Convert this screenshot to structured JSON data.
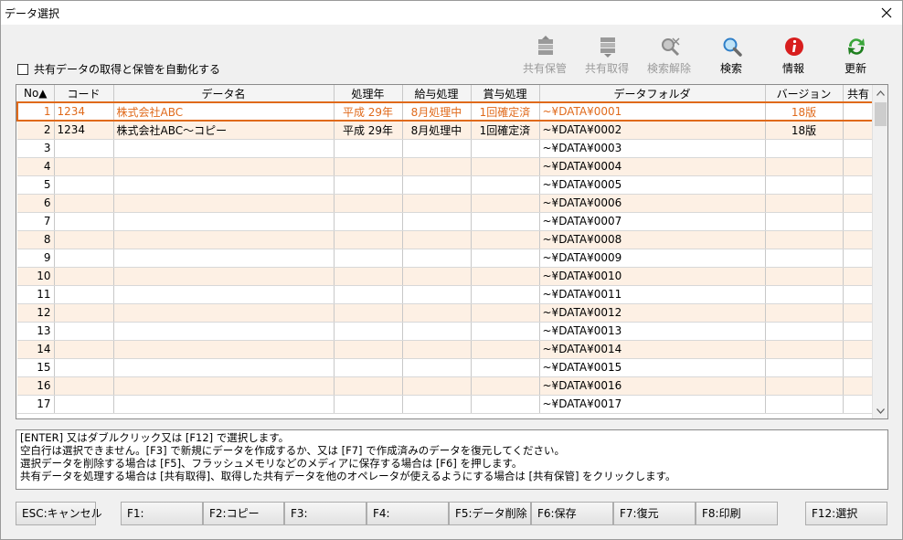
{
  "window": {
    "title": "データ選択"
  },
  "autosync": {
    "label": "共有データの取得と保管を自動化する",
    "checked": false
  },
  "toolbar": {
    "share_save": "共有保管",
    "share_get": "共有取得",
    "search_clear": "検索解除",
    "search": "検索",
    "info": "情報",
    "refresh": "更新"
  },
  "grid": {
    "columns": [
      "No▲",
      "コード",
      "データ名",
      "処理年",
      "給与処理",
      "賞与処理",
      "データフォルダ",
      "バージョン",
      "共有"
    ],
    "rows": [
      {
        "no": "1",
        "code": "1234",
        "name": "株式会社ABC",
        "year": "平成 29年",
        "salary": "8月処理中",
        "bonus": "1回確定済",
        "folder": "~¥DATA¥0001",
        "version": "18版",
        "shared": ""
      },
      {
        "no": "2",
        "code": "1234",
        "name": "株式会社ABC～コピー",
        "year": "平成 29年",
        "salary": "8月処理中",
        "bonus": "1回確定済",
        "folder": "~¥DATA¥0002",
        "version": "18版",
        "shared": ""
      },
      {
        "no": "3",
        "code": "",
        "name": "",
        "year": "",
        "salary": "",
        "bonus": "",
        "folder": "~¥DATA¥0003",
        "version": "",
        "shared": ""
      },
      {
        "no": "4",
        "code": "",
        "name": "",
        "year": "",
        "salary": "",
        "bonus": "",
        "folder": "~¥DATA¥0004",
        "version": "",
        "shared": ""
      },
      {
        "no": "5",
        "code": "",
        "name": "",
        "year": "",
        "salary": "",
        "bonus": "",
        "folder": "~¥DATA¥0005",
        "version": "",
        "shared": ""
      },
      {
        "no": "6",
        "code": "",
        "name": "",
        "year": "",
        "salary": "",
        "bonus": "",
        "folder": "~¥DATA¥0006",
        "version": "",
        "shared": ""
      },
      {
        "no": "7",
        "code": "",
        "name": "",
        "year": "",
        "salary": "",
        "bonus": "",
        "folder": "~¥DATA¥0007",
        "version": "",
        "shared": ""
      },
      {
        "no": "8",
        "code": "",
        "name": "",
        "year": "",
        "salary": "",
        "bonus": "",
        "folder": "~¥DATA¥0008",
        "version": "",
        "shared": ""
      },
      {
        "no": "9",
        "code": "",
        "name": "",
        "year": "",
        "salary": "",
        "bonus": "",
        "folder": "~¥DATA¥0009",
        "version": "",
        "shared": ""
      },
      {
        "no": "10",
        "code": "",
        "name": "",
        "year": "",
        "salary": "",
        "bonus": "",
        "folder": "~¥DATA¥0010",
        "version": "",
        "shared": ""
      },
      {
        "no": "11",
        "code": "",
        "name": "",
        "year": "",
        "salary": "",
        "bonus": "",
        "folder": "~¥DATA¥0011",
        "version": "",
        "shared": ""
      },
      {
        "no": "12",
        "code": "",
        "name": "",
        "year": "",
        "salary": "",
        "bonus": "",
        "folder": "~¥DATA¥0012",
        "version": "",
        "shared": ""
      },
      {
        "no": "13",
        "code": "",
        "name": "",
        "year": "",
        "salary": "",
        "bonus": "",
        "folder": "~¥DATA¥0013",
        "version": "",
        "shared": ""
      },
      {
        "no": "14",
        "code": "",
        "name": "",
        "year": "",
        "salary": "",
        "bonus": "",
        "folder": "~¥DATA¥0014",
        "version": "",
        "shared": ""
      },
      {
        "no": "15",
        "code": "",
        "name": "",
        "year": "",
        "salary": "",
        "bonus": "",
        "folder": "~¥DATA¥0015",
        "version": "",
        "shared": ""
      },
      {
        "no": "16",
        "code": "",
        "name": "",
        "year": "",
        "salary": "",
        "bonus": "",
        "folder": "~¥DATA¥0016",
        "version": "",
        "shared": ""
      },
      {
        "no": "17",
        "code": "",
        "name": "",
        "year": "",
        "salary": "",
        "bonus": "",
        "folder": "~¥DATA¥0017",
        "version": "",
        "shared": ""
      }
    ]
  },
  "messages": [
    "[ENTER] 又はダブルクリック又は [F12] で選択します。",
    "空白行は選択できません。[F3] で新規にデータを作成するか、又は [F7] で作成済みのデータを復元してください。",
    "選択データを削除する場合は [F5]、フラッシュメモリなどのメディアに保存する場合は [F6] を押します。",
    "共有データを処理する場合は [共有取得]、取得した共有データを他のオペレータが使えるようにする場合は [共有保管] をクリックします。"
  ],
  "fkeys": [
    "ESC:キャンセル",
    "F1:",
    "F2:コピー",
    "F3:",
    "F4:",
    "F5:データ削除",
    "F6:保存",
    "F7:復元",
    "F8:印刷",
    "F12:選択"
  ],
  "colors": {
    "accent": "#e06a1b",
    "row_alt": "#fdf0e4"
  }
}
